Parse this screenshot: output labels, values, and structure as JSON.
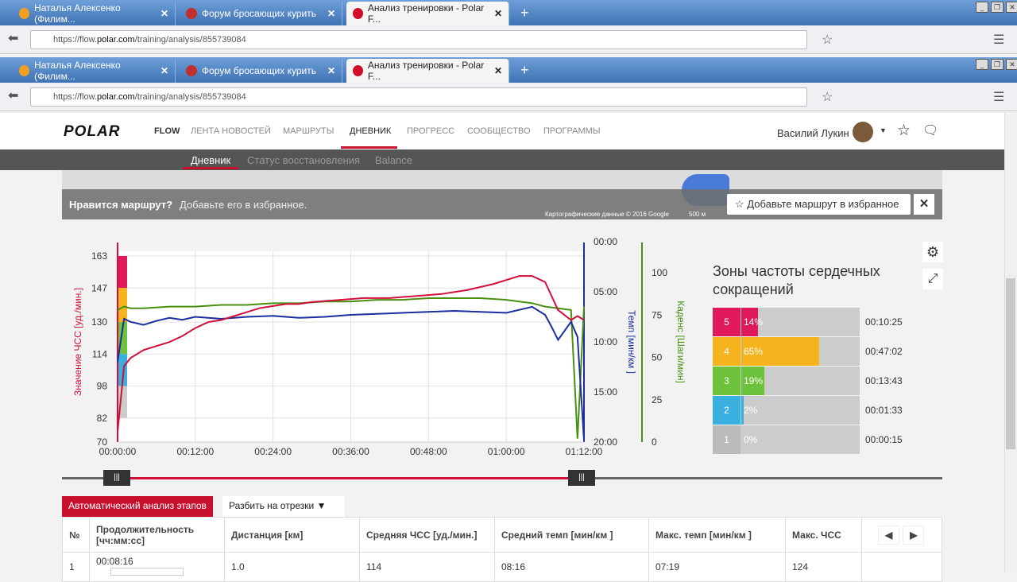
{
  "browser": {
    "tabs": [
      {
        "label": "Наталья Алексенко (Филим...",
        "color": "#f0a020"
      },
      {
        "label": "Форум бросающих курить",
        "color": "#c03030"
      },
      {
        "label": "Анализ тренировки - Polar F...",
        "color": "#d0102a"
      }
    ],
    "url_prefix": "https://flow.",
    "url_domain": "polar.com",
    "url_path": "/training/analysis/855739084"
  },
  "header": {
    "logo": "POLAR",
    "flow": "FLOW",
    "nav": [
      "ЛЕНТА НОВОСТЕЙ",
      "МАРШРУТЫ",
      "ДНЕВНИК",
      "ПРОГРЕСС",
      "СООБЩЕСТВО",
      "ПРОГРАММЫ"
    ],
    "user": "Василий Лукин"
  },
  "subnav": [
    "Дневник",
    "Статус восстановления",
    "Balance"
  ],
  "map": {
    "question": "Нравится маршрут?",
    "hint": "Добавьте его в избранное.",
    "fav_button": "Добавьте маршрут в избранное",
    "credits": "Картографические данные © 2016 Google",
    "scale": "500 м"
  },
  "chart_data": {
    "type": "line",
    "x_ticks": [
      "00:00:00",
      "00:12:00",
      "00:24:00",
      "00:36:00",
      "00:48:00",
      "01:00:00",
      "01:12:00"
    ],
    "xlim": [
      0,
      72
    ],
    "ylabel_left": "Значение ЧСС [уд./мин.]",
    "y_ticks_left": [
      "163",
      "147",
      "130",
      "114",
      "98",
      "82",
      "70"
    ],
    "ylim_left": [
      70,
      163
    ],
    "ylabel_pace": "Темп [мин/км ]",
    "y_ticks_pace": [
      "00:00",
      "05:00",
      "10:00",
      "15:00",
      "20:00"
    ],
    "ylim_pace": [
      0,
      20
    ],
    "ylabel_cadence": "Каденс [Шаги/мин]",
    "y_ticks_cadence": [
      "100",
      "75",
      "50",
      "25",
      "0"
    ],
    "ylim_cadence": [
      0,
      100
    ],
    "series": [
      {
        "name": "ЧСС",
        "color": "#d0103a",
        "axis": "left",
        "x": [
          0,
          1,
          2,
          4,
          6,
          8,
          10,
          12,
          14,
          16,
          18,
          20,
          22,
          24,
          26,
          28,
          30,
          34,
          38,
          42,
          46,
          50,
          54,
          58,
          60,
          62,
          64,
          66,
          68,
          70,
          71,
          72
        ],
        "y": [
          75,
          108,
          112,
          116,
          118,
          120,
          123,
          127,
          130,
          131,
          133,
          135,
          137,
          138,
          139,
          139,
          140,
          141,
          142,
          142,
          143,
          144,
          146,
          149,
          151,
          153,
          153,
          150,
          136,
          131,
          133,
          131
        ]
      },
      {
        "name": "Темп",
        "color": "#1a2ea0",
        "axis": "pace",
        "x": [
          0,
          1,
          2,
          4,
          6,
          8,
          10,
          12,
          16,
          20,
          24,
          28,
          32,
          36,
          40,
          44,
          48,
          52,
          56,
          60,
          64,
          66,
          67,
          68,
          70,
          71,
          72
        ],
        "y": [
          12,
          7.7,
          8,
          8.3,
          7.9,
          7.6,
          7.8,
          7.5,
          7.7,
          7.5,
          7.4,
          7.6,
          7.5,
          7.3,
          7.2,
          7.1,
          7.0,
          6.9,
          7.0,
          7.1,
          6.5,
          7.3,
          8.5,
          9.8,
          8.0,
          9.5,
          19.8
        ]
      },
      {
        "name": "Каденс",
        "color": "#4a9010",
        "axis": "cadence",
        "x": [
          0,
          1,
          2,
          4,
          8,
          12,
          16,
          20,
          24,
          28,
          32,
          36,
          40,
          44,
          48,
          52,
          56,
          60,
          64,
          66,
          68,
          70,
          71,
          72
        ],
        "y": [
          78,
          80,
          79,
          79,
          80,
          80,
          81,
          81,
          82,
          82,
          83,
          83,
          84,
          84,
          85,
          85,
          85,
          84,
          82,
          80,
          79,
          78,
          2,
          80
        ]
      }
    ],
    "zone_band_colors": [
      "#e0195a",
      "#f5b41e",
      "#6cc23a",
      "#3ab0e0",
      "#cccccc"
    ]
  },
  "zones": {
    "title": "Зоны частоты сердечных сокращений",
    "items": [
      {
        "zone": "5",
        "pct": "14%",
        "value": 14,
        "time": "00:10:25",
        "color": "#e0195a"
      },
      {
        "zone": "4",
        "pct": "65%",
        "value": 65,
        "time": "00:47:02",
        "color": "#f5b41e"
      },
      {
        "zone": "3",
        "pct": "19%",
        "value": 19,
        "time": "00:13:43",
        "color": "#6cc23a"
      },
      {
        "zone": "2",
        "pct": "2%",
        "value": 2,
        "time": "00:01:33",
        "color": "#3ab0e0"
      },
      {
        "zone": "1",
        "pct": "0%",
        "value": 0,
        "time": "00:00:15",
        "color": "#bbbbbb"
      }
    ]
  },
  "laps": {
    "tab_auto": "Автоматический анализ этапов",
    "tab_split": "Разбить на отрезки",
    "columns": [
      "№",
      "Продолжительность [чч:мм:сс]",
      "Дистанция [км]",
      "Средняя ЧСС [уд./мин.]",
      "Средний темп [мин/км ]",
      "Макс. темп [мин/км ]",
      "Макс. ЧСС"
    ],
    "rows": [
      [
        "1",
        "00:08:16",
        "1.0",
        "114",
        "08:16",
        "07:19",
        "124"
      ]
    ]
  }
}
